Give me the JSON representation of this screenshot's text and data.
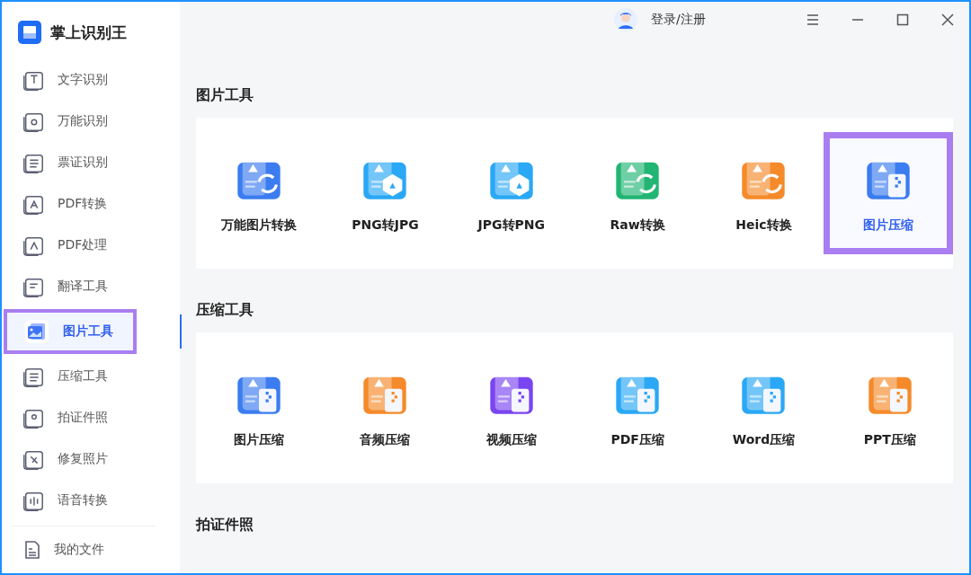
{
  "app": {
    "title": "掌上识别王"
  },
  "header": {
    "login": "登录/注册"
  },
  "sidebar": {
    "items": [
      {
        "label": "文字识别",
        "selected": false,
        "kind": "text"
      },
      {
        "label": "万能识别",
        "selected": false,
        "kind": "search"
      },
      {
        "label": "票证识别",
        "selected": false,
        "kind": "ticket"
      },
      {
        "label": "PDF转换",
        "selected": false,
        "kind": "pdf"
      },
      {
        "label": "PDF处理",
        "selected": false,
        "kind": "pdfedit"
      },
      {
        "label": "翻译工具",
        "selected": false,
        "kind": "chat"
      },
      {
        "label": "图片工具",
        "selected": true,
        "kind": "image"
      },
      {
        "label": "压缩工具",
        "selected": false,
        "kind": "ticket"
      },
      {
        "label": "拍证件照",
        "selected": false,
        "kind": "person"
      },
      {
        "label": "修复照片",
        "selected": false,
        "kind": "repair"
      },
      {
        "label": "语音转换",
        "selected": false,
        "kind": "voice"
      }
    ],
    "footer": "我的文件"
  },
  "sections": [
    {
      "title": "图片工具",
      "tools": [
        {
          "label": "万能图片转换",
          "color": "#3b7cf0",
          "kind": "convert",
          "selected": false
        },
        {
          "label": "PNG转JPG",
          "color": "#2aa8f5",
          "kind": "badge",
          "selected": false
        },
        {
          "label": "JPG转PNG",
          "color": "#2aa8f5",
          "kind": "badge",
          "selected": false
        },
        {
          "label": "Raw转换",
          "color": "#22b573",
          "kind": "convert",
          "selected": false
        },
        {
          "label": "Heic转换",
          "color": "#f58a2a",
          "kind": "convert",
          "selected": false
        },
        {
          "label": "图片压缩",
          "color": "#3b7cf0",
          "kind": "zip",
          "selected": true
        }
      ]
    },
    {
      "title": "压缩工具",
      "tools": [
        {
          "label": "图片压缩",
          "color": "#3b7cf0",
          "kind": "zip",
          "selected": false
        },
        {
          "label": "音频压缩",
          "color": "#f58a2a",
          "kind": "zip",
          "selected": false
        },
        {
          "label": "视频压缩",
          "color": "#7a45f0",
          "kind": "zip",
          "selected": false
        },
        {
          "label": "PDF压缩",
          "color": "#2aa8f5",
          "kind": "zip",
          "selected": false
        },
        {
          "label": "Word压缩",
          "color": "#2aa8f5",
          "kind": "zip",
          "selected": false
        },
        {
          "label": "PPT压缩",
          "color": "#f58a2a",
          "kind": "zip",
          "selected": false
        }
      ]
    },
    {
      "title": "拍证件照"
    }
  ]
}
